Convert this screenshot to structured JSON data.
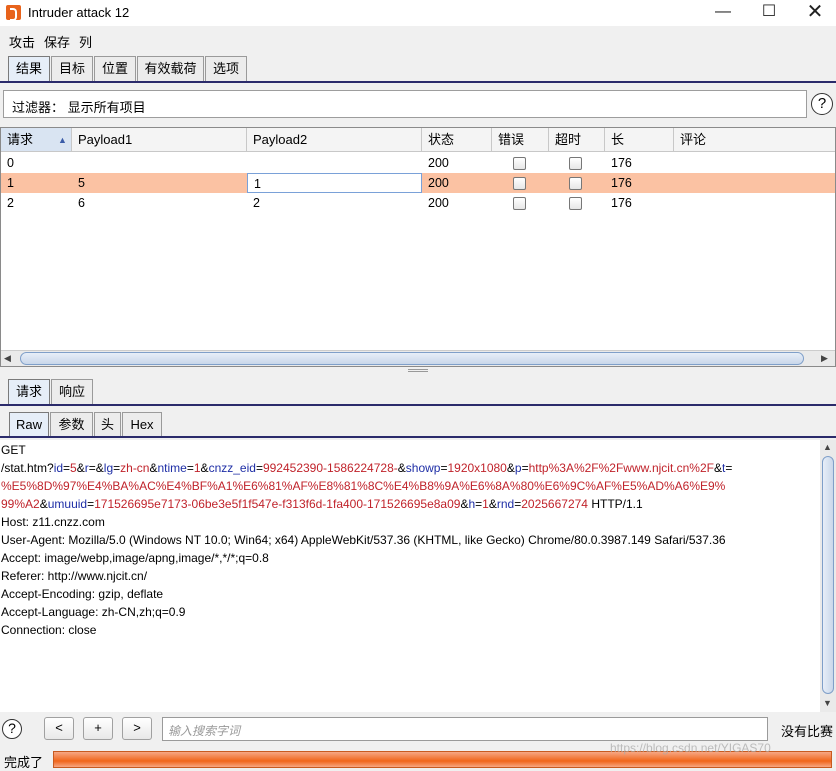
{
  "window": {
    "title": "Intruder attack 12",
    "minimize": "—",
    "maximize": "☐",
    "close": "✕"
  },
  "menu": [
    "攻击",
    "保存",
    "列"
  ],
  "main_tabs": [
    "结果",
    "目标",
    "位置",
    "有效载荷",
    "选项"
  ],
  "filter": {
    "text": "过滤器：  显示所有项目",
    "help": "?"
  },
  "table": {
    "headers": [
      "请求",
      "Payload1",
      "Payload2",
      "状态",
      "错误",
      "超时",
      "长",
      "评论"
    ],
    "sort_indicator": "▲",
    "rows": [
      {
        "request": "0",
        "payload1": "",
        "payload2": "",
        "status": "200",
        "length": "176"
      },
      {
        "request": "1",
        "payload1": "5",
        "payload2": "1",
        "status": "200",
        "length": "176"
      },
      {
        "request": "2",
        "payload1": "6",
        "payload2": "2",
        "status": "200",
        "length": "176"
      }
    ],
    "selected_row_color": "#fbc2a3"
  },
  "pane_tabs": [
    "请求",
    "响应"
  ],
  "view_tabs": [
    "Raw",
    "参数",
    "头",
    "Hex"
  ],
  "raw": {
    "line1": "GET",
    "l2": {
      "p0": "/stat.htm?",
      "k1": "id",
      "e1": "=",
      "v1": "5",
      "a1": "&",
      "k2": "r",
      "e2": "=",
      "a2": "&",
      "k3": "lg",
      "e3": "=",
      "v3": "zh-cn",
      "a3": "&",
      "k4": "ntime",
      "e4": "=",
      "v4": "1",
      "a4": "&",
      "k5": "cnzz_eid",
      "e5": "=",
      "v5": "992452390-1586224728-",
      "a5": "&",
      "k6": "showp",
      "e6": "=",
      "v6": "1920x1080",
      "a6": "&",
      "k7": "p",
      "e7": "=",
      "v7": "http%3A%2F%2Fwww.njcit.cn%2F",
      "a7": "&",
      "k8": "t",
      "e8": "="
    },
    "l3": {
      "v8": "%E5%8D%97%E4%BA%AC%E4%BF%A1%E6%81%AF%E8%81%8C%E4%B8%9A%E6%8A%80%E6%9C%AF%E5%AD%A6%E9%"
    },
    "l4": {
      "v8b": "99%A2",
      "a8": "&",
      "k9": "umuuid",
      "e9": "=",
      "v9": "171526695e7173-06be3e5f1f547e-f313f6d-1fa400-171526695e8a09",
      "a9": "&",
      "k10": "h",
      "e10": "=",
      "v10": "1",
      "a10": "&",
      "k11": "rnd",
      "e11": "=",
      "v11": "2025667274",
      "tail": " HTTP/1.1"
    },
    "headers": [
      "Host: z11.cnzz.com",
      "User-Agent: Mozilla/5.0 (Windows NT 10.0; Win64; x64) AppleWebKit/537.36 (KHTML, like Gecko) Chrome/80.0.3987.149 Safari/537.36",
      "Accept: image/webp,image/apng,image/*,*/*;q=0.8",
      "Referer: http://www.njcit.cn/",
      "Accept-Encoding: gzip, deflate",
      "Accept-Language: zh-CN,zh;q=0.9",
      "Connection: close"
    ]
  },
  "search": {
    "help": "?",
    "prev": "<",
    "add": "+",
    "next": ">",
    "placeholder": "输入搜索字词",
    "match_text": "没有比赛"
  },
  "status": {
    "text": "完成了",
    "progress": 1.0,
    "watermark": "https://blog.csdn.net/YIGAS70"
  },
  "colors": {
    "accent_line": "#2b2b6b",
    "progress": "#f0661b",
    "key": "#1e2ea6",
    "value": "#c0232b"
  }
}
